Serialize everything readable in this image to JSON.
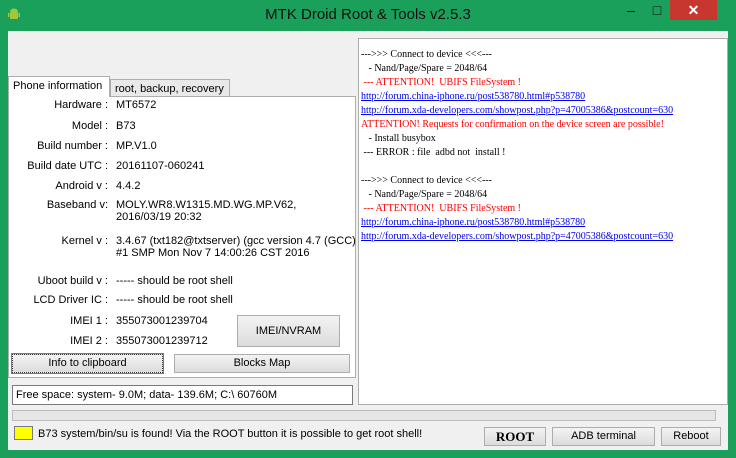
{
  "window": {
    "title": "MTK Droid Root & Tools v2.5.3",
    "minimize": "–",
    "maximize": "□",
    "close": "✕"
  },
  "tabs": [
    {
      "label": "Phone information"
    },
    {
      "label": "root, backup, recovery"
    }
  ],
  "info": {
    "hardware_label": "Hardware :",
    "hardware": "MT6572",
    "model_label": "Model :",
    "model": "B73",
    "build_label": "Build number :",
    "build": "MP.V1.0",
    "date_label": "Build date UTC :",
    "date": "20161107-060241",
    "android_label": "Android  v :",
    "android": "4.4.2",
    "baseband_label": "Baseband v:",
    "baseband_1": "MOLY.WR8.W1315.MD.WG.MP.V62,",
    "baseband_2": "2016/03/19 20:32",
    "kernel_label": "Kernel v :",
    "kernel_1": "3.4.67 (txt182@txtserver) (gcc version 4.7 (GCC) )",
    "kernel_2": "#1 SMP  Mon Nov 7 14:00:26 CST 2016",
    "uboot_label": "Uboot build v :",
    "uboot": "----- should be  root shell",
    "lcd_label": "LCD Driver IC :",
    "lcd": "----- should be  root shell",
    "imei1_label": "IMEI 1 :",
    "imei1": "355073001239704",
    "imei2_label": "IMEI 2 :",
    "imei2": "355073001239712"
  },
  "buttons": {
    "imei_nvram": "IMEI/NVRAM",
    "info_clipboard": "Info to clipboard",
    "blocks_map": "Blocks Map",
    "root": "ROOT",
    "adb_terminal": "ADB terminal",
    "reboot": "Reboot"
  },
  "free_space": "Free space: system- 9.0M; data- 139.6M;  C:\\ 60760M",
  "log": [
    {
      "text": "--->>> Connect to device <<<---",
      "color": "black"
    },
    {
      "text": "   - Nand/Page/Spare = 2048/64",
      "color": "black"
    },
    {
      "text": " --- ATTENTION!  UBIFS FileSystem !",
      "color": "red"
    },
    {
      "text": "http://forum.china-iphone.ru/post538780.html#p538780",
      "color": "link"
    },
    {
      "text": "http://forum.xda-developers.com/showpost.php?p=47005386&postcount=630",
      "color": "link"
    },
    {
      "text": "ATTENTION! Requests for confirmation on the device screen are possible!",
      "color": "red"
    },
    {
      "text": "   - Install busybox",
      "color": "black"
    },
    {
      "text": " --- ERROR : file  adbd not  install !",
      "color": "black"
    },
    {
      "text": "",
      "color": "black"
    },
    {
      "text": "--->>> Connect to device <<<---",
      "color": "black"
    },
    {
      "text": "   - Nand/Page/Spare = 2048/64",
      "color": "black"
    },
    {
      "text": " --- ATTENTION!  UBIFS FileSystem !",
      "color": "red"
    },
    {
      "text": "http://forum.china-iphone.ru/post538780.html#p538780",
      "color": "link"
    },
    {
      "text": "http://forum.xda-developers.com/showpost.php?p=47005386&postcount=630",
      "color": "link"
    }
  ],
  "status_text": "B73 system/bin/su is found! Via the ROOT button it is possible to get root shell!",
  "colors": {
    "accent": "#1aa05a",
    "indicator": "#ffff00",
    "close_button": "#c7372f"
  }
}
